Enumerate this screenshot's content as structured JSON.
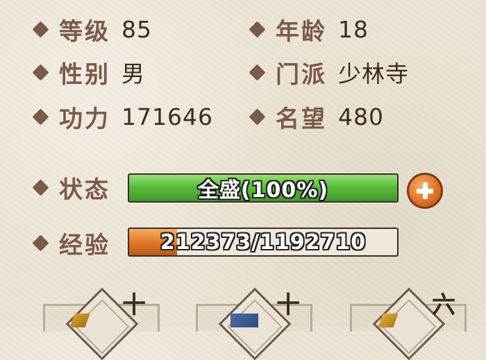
{
  "stats": [
    {
      "label": "等级",
      "value": "85"
    },
    {
      "label": "年龄",
      "value": "18"
    },
    {
      "label": "性别",
      "value": "男"
    },
    {
      "label": "门派",
      "value": "少林寺"
    },
    {
      "label": "功力",
      "value": "171646"
    },
    {
      "label": "名望",
      "value": "480"
    }
  ],
  "status": {
    "label": "状态",
    "text": "全盛(100%)",
    "fill_fraction": 1.0,
    "color": "#4caf33"
  },
  "experience": {
    "label": "经验",
    "text": "212373/1192710",
    "current": 212373,
    "max": 1192710,
    "color": "#e07a2a"
  },
  "add_button": {
    "icon": "plus-icon",
    "color": "#e0722a"
  },
  "slots": [
    {
      "rank": "十"
    },
    {
      "rank": "十"
    },
    {
      "rank": "六"
    }
  ]
}
